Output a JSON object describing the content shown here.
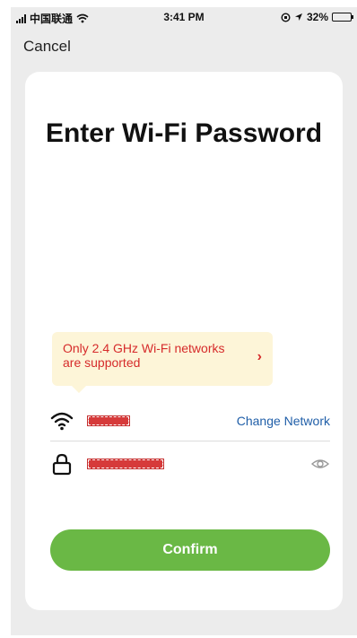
{
  "status_bar": {
    "carrier": "中国联通",
    "time": "3:41 PM",
    "battery": "32%",
    "battery_level": 0.32
  },
  "nav": {
    "cancel_label": "Cancel"
  },
  "page": {
    "title": "Enter Wi-Fi Password"
  },
  "hint": {
    "text": "Only 2.4 GHz Wi-Fi networks are supported"
  },
  "network": {
    "change_label": "Change Network"
  },
  "actions": {
    "confirm_label": "Confirm"
  },
  "colors": {
    "accent_green": "#6ab845",
    "link_blue": "#1f5ea8",
    "warning_red": "#d62b2b",
    "hint_bg": "#fdf5d8"
  },
  "icons": {
    "wifi": "wifi-icon",
    "lock": "lock-icon",
    "eye": "eye-icon",
    "chevron": "chevron-right-icon"
  }
}
